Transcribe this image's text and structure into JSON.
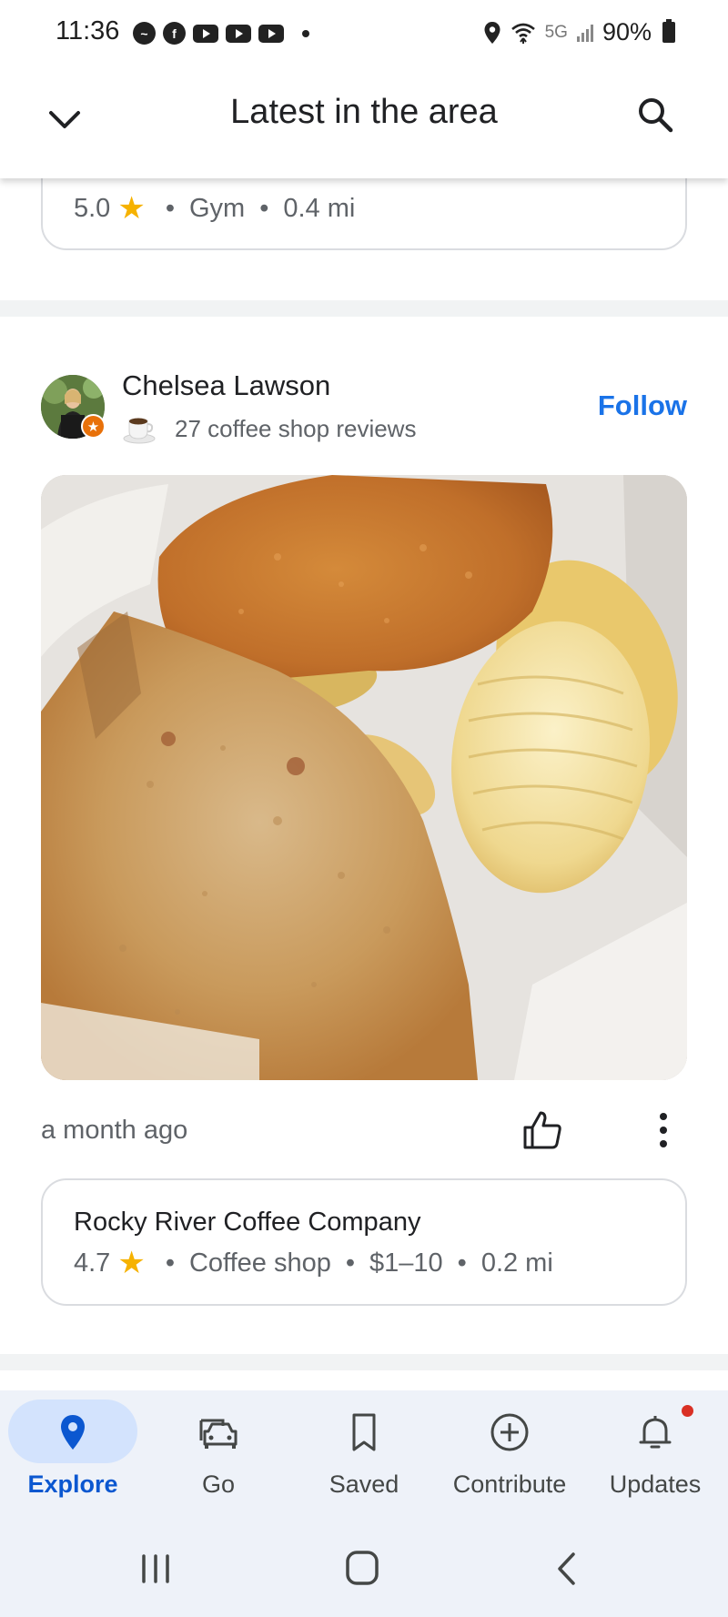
{
  "status_bar": {
    "time": "11:36",
    "network": "5G",
    "battery": "90%",
    "icons": [
      "messenger-icon",
      "facebook-icon",
      "youtube-icon",
      "youtube-icon",
      "youtube-icon",
      "dot-icon",
      "location-icon",
      "wifi-icon",
      "signal-icon",
      "battery-icon"
    ]
  },
  "header": {
    "title": "Latest in the area",
    "back_icon": "chevron-down-icon",
    "search_icon": "search-icon"
  },
  "previous_card": {
    "rating": "5.0",
    "category": "Gym",
    "distance": "0.4 mi"
  },
  "post": {
    "author_name": "Chelsea Lawson",
    "author_subtitle": "27 coffee shop reviews",
    "follow_label": "Follow",
    "time_ago": "a month ago",
    "like_icon": "thumbs-up-icon",
    "more_icon": "more-vert-icon"
  },
  "place_card": {
    "name": "Rocky River Coffee Company",
    "rating": "4.7",
    "category": "Coffee shop",
    "price": "$1–10",
    "distance": "0.2 mi"
  },
  "bottom_nav": {
    "items": [
      {
        "label": "Explore",
        "icon": "location-pin-icon",
        "active": true
      },
      {
        "label": "Go",
        "icon": "car-icon",
        "active": false
      },
      {
        "label": "Saved",
        "icon": "bookmark-icon",
        "active": false
      },
      {
        "label": "Contribute",
        "icon": "add-circle-icon",
        "active": false
      },
      {
        "label": "Updates",
        "icon": "bell-icon",
        "active": false
      }
    ]
  },
  "colors": {
    "accent": "#1a73e8",
    "star": "#f6b200",
    "nav_active_pill": "#d3e3fd",
    "nav_background": "#eef2f9",
    "notification_dot": "#d93025"
  }
}
